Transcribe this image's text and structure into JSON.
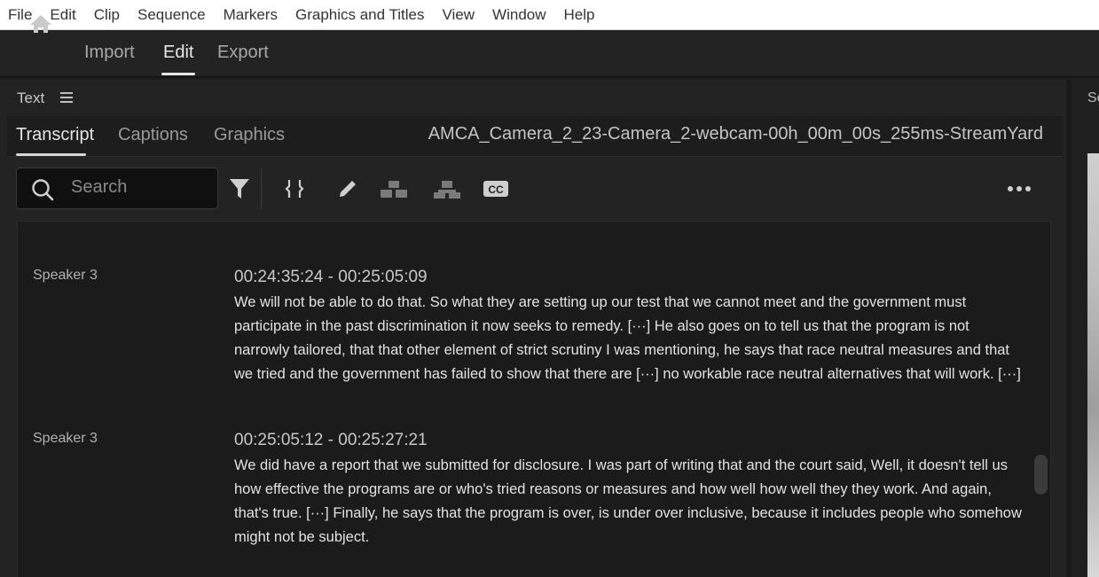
{
  "menubar": [
    "File",
    "Edit",
    "Clip",
    "Sequence",
    "Markers",
    "Graphics and Titles",
    "View",
    "Window",
    "Help"
  ],
  "workspace": {
    "tabs": [
      "Import",
      "Edit",
      "Export"
    ],
    "active_tab": "Edit"
  },
  "panel": {
    "title": "Text",
    "tabs": [
      "Transcript",
      "Captions",
      "Graphics"
    ],
    "active_tab": "Transcript",
    "clip_name": "AMCA_Camera_2_23-Camera_2-webcam-00h_00m_00s_255ms-StreamYard"
  },
  "search": {
    "placeholder": "Search"
  },
  "toolbar_icons": [
    "filter-icon",
    "split-segment-icon",
    "edit-pencil-icon",
    "merge-segments-icon",
    "split-speaker-icon",
    "cc-icon",
    "more-options-icon"
  ],
  "transcript": [
    {
      "speaker": "Speaker 3",
      "timecode": "00:24:35:24 - 00:25:05:09",
      "text": "We will not be able to do that. So what they are setting up our test that we cannot meet and the government must participate in the past discrimination it now seeks to remedy. [···] He also goes on to tell us that the program is not narrowly tailored, that that other element of strict scrutiny I was mentioning, he says that race neutral measures and that we tried and the government has failed to show that there are [···] no workable race neutral alternatives that will work. [···]"
    },
    {
      "speaker": "Speaker 3",
      "timecode": "00:25:05:12 - 00:25:27:21",
      "text": "We did have a report that we submitted for disclosure. I was part of writing that and the court said, Well, it doesn't tell us how effective the programs are or who's tried reasons or measures and how well how well they they work. And again, that's true. [···] Finally, he says that the program is over, is under over inclusive, because it includes people who somehow might not be subject."
    }
  ],
  "right_panel": {
    "title": "Se"
  },
  "colors": {
    "background": "#232323",
    "content_bg": "#1b1b1b",
    "text": "#e2e2e2",
    "menubar_bg": "#ffffff"
  }
}
